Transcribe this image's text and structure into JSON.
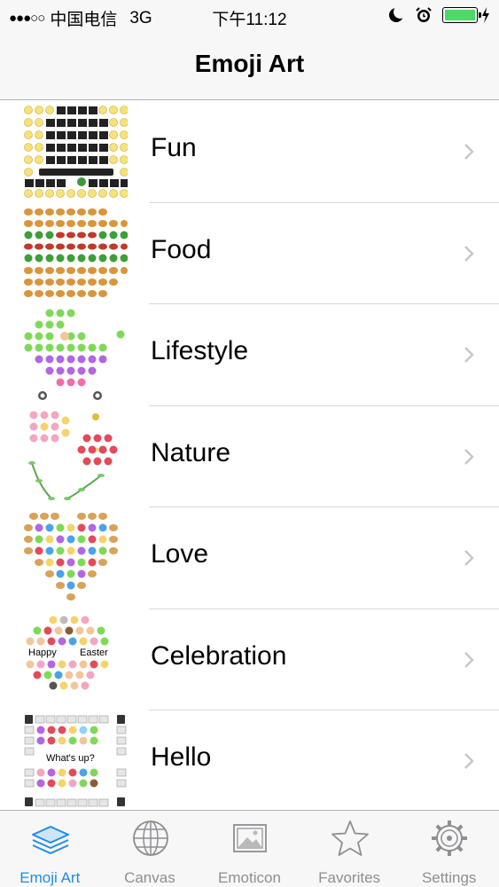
{
  "status_bar": {
    "signal": "●●●○○",
    "carrier": "中国电信",
    "network": "3G",
    "time": "下午11:12",
    "battery_level": 1.0,
    "battery_color": "#4cd964"
  },
  "nav": {
    "title": "Emoji Art"
  },
  "categories": [
    {
      "label": "Fun",
      "icon": "hat-star-emoji-art"
    },
    {
      "label": "Food",
      "icon": "burger-clover-emoji-art"
    },
    {
      "label": "Lifestyle",
      "icon": "heart-pot-emoji-art"
    },
    {
      "label": "Nature",
      "icon": "flower-vine-emoji-art"
    },
    {
      "label": "Love",
      "icon": "heart-palette-emoji-art"
    },
    {
      "label": "Celebration",
      "icon": "happy-easter-emoji-art",
      "thumb_text": [
        "Happy",
        "Easter"
      ]
    },
    {
      "label": "Hello",
      "icon": "whats-up-emoji-art",
      "thumb_text": [
        "What's up?"
      ]
    }
  ],
  "tabs": [
    {
      "label": "Emoji Art",
      "icon": "layers-icon",
      "active": true
    },
    {
      "label": "Canvas",
      "icon": "globe-icon",
      "active": false
    },
    {
      "label": "Emoticon",
      "icon": "picture-icon",
      "active": false
    },
    {
      "label": "Favorites",
      "icon": "star-icon",
      "active": false
    },
    {
      "label": "Settings",
      "icon": "gear-icon",
      "active": false
    }
  ],
  "colors": {
    "accent": "#1f8be8",
    "inactive": "#8e8e93",
    "bar_bg": "#f7f7f7"
  }
}
